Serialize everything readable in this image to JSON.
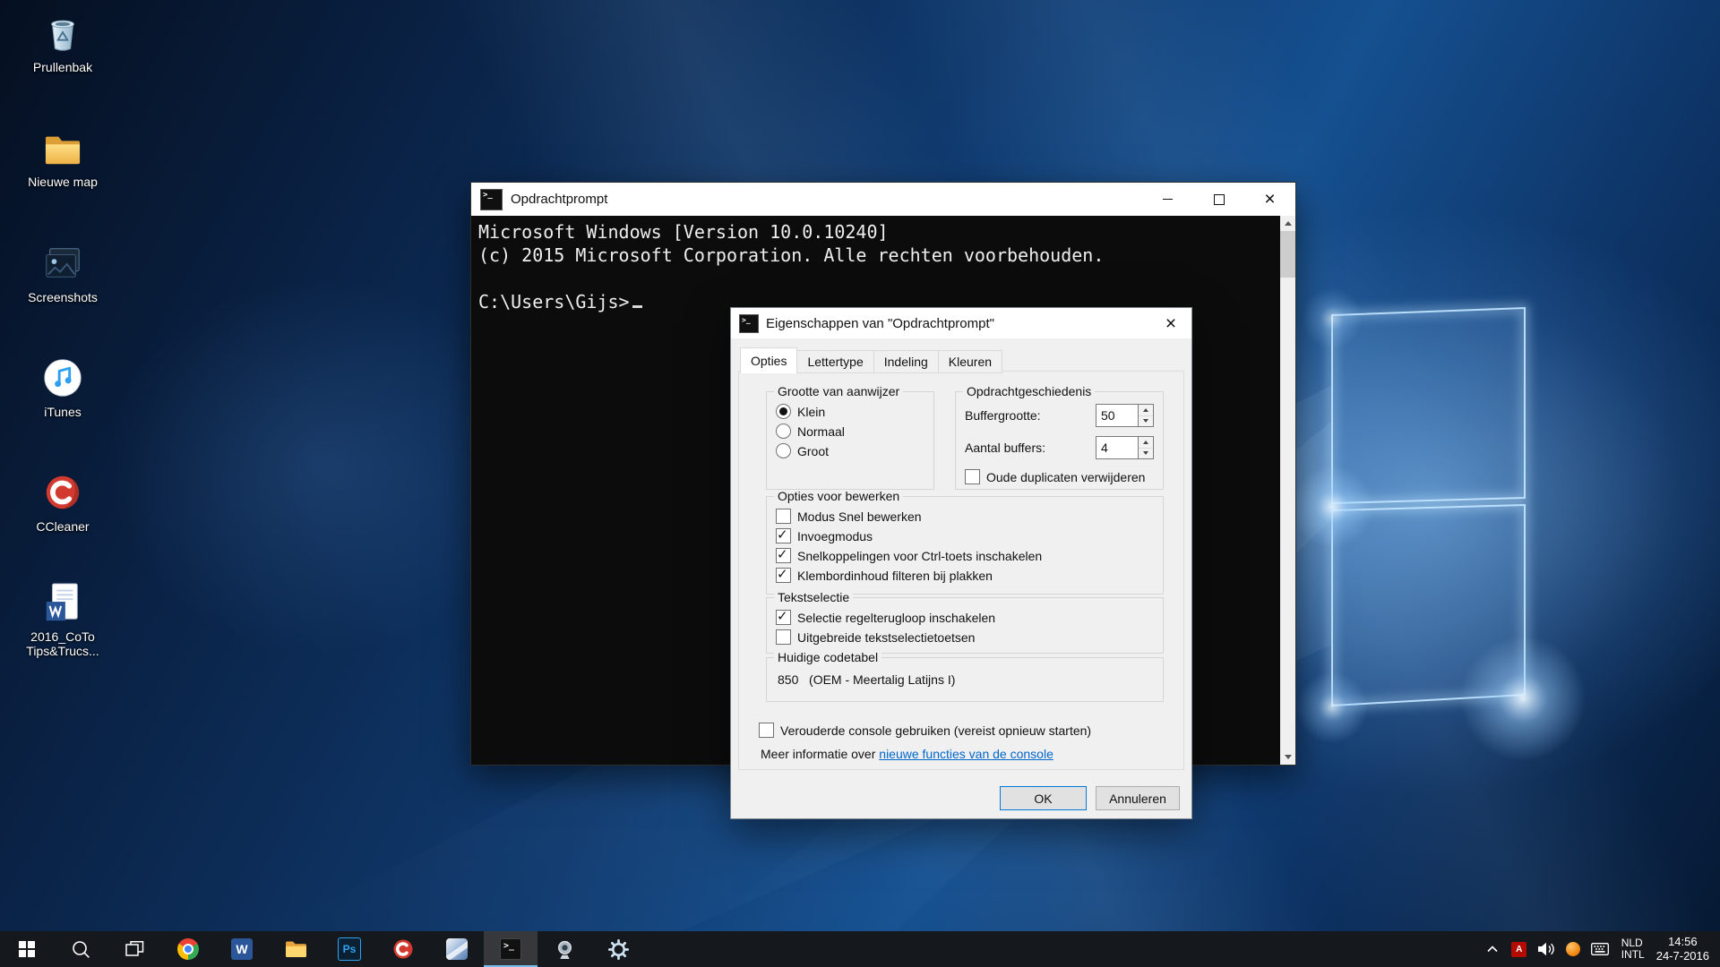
{
  "glyphs": {
    "cmd": ">_",
    "word": "W",
    "photoshop": "Ps",
    "adobe": "A"
  },
  "desktop": {
    "icons": [
      {
        "name": "recycle-bin",
        "label": "Prullenbak"
      },
      {
        "name": "new-folder",
        "label": "Nieuwe map"
      },
      {
        "name": "screenshots-folder",
        "label": "Screenshots"
      },
      {
        "name": "itunes",
        "label": "iTunes"
      },
      {
        "name": "ccleaner",
        "label": "CCleaner"
      },
      {
        "name": "word-document",
        "label": "2016_CoTo Tips&Trucs...",
        "line1": "2016_CoTo",
        "line2": "Tips&Trucs..."
      }
    ]
  },
  "console": {
    "title": "Opdrachtprompt",
    "line1": "Microsoft Windows [Version 10.0.10240]",
    "line2": "(c) 2015 Microsoft Corporation. Alle rechten voorbehouden.",
    "prompt": "C:\\Users\\Gijs>"
  },
  "dialog": {
    "title": "Eigenschappen van \"Opdrachtprompt\"",
    "tabs": [
      {
        "label": "Opties",
        "active": true
      },
      {
        "label": "Lettertype",
        "active": false
      },
      {
        "label": "Indeling",
        "active": false
      },
      {
        "label": "Kleuren",
        "active": false
      }
    ],
    "cursor_group": {
      "title": "Grootte van aanwijzer",
      "options": [
        {
          "label": "Klein",
          "selected": true
        },
        {
          "label": "Normaal",
          "selected": false
        },
        {
          "label": "Groot",
          "selected": false
        }
      ]
    },
    "history_group": {
      "title": "Opdrachtgeschiedenis",
      "buffer_label": "Buffergrootte:",
      "buffer_value": "50",
      "count_label": "Aantal buffers:",
      "count_value": "4",
      "dup_checkbox": {
        "label": "Oude duplicaten verwijderen",
        "checked": false
      }
    },
    "edit_group": {
      "title": "Opties voor bewerken",
      "items": [
        {
          "label": "Modus Snel bewerken",
          "checked": false
        },
        {
          "label": "Invoegmodus",
          "checked": true
        },
        {
          "label": "Snelkoppelingen voor Ctrl-toets inschakelen",
          "checked": true
        },
        {
          "label": "Klembordinhoud filteren bij plakken",
          "checked": true
        }
      ]
    },
    "selection_group": {
      "title": "Tekstselectie",
      "items": [
        {
          "label": "Selectie regelterugloop inschakelen",
          "checked": true
        },
        {
          "label": "Uitgebreide tekstselectietoetsen",
          "checked": false
        }
      ]
    },
    "codepage_group": {
      "title": "Huidige codetabel",
      "value": "850   (OEM - Meertalig Latijns I)"
    },
    "legacy_checkbox": {
      "label": "Verouderde console gebruiken (vereist opnieuw starten)",
      "checked": false
    },
    "info_prefix": "Meer informatie over ",
    "info_link": "nieuwe functies van de console",
    "ok_label": "OK",
    "cancel_label": "Annuleren"
  },
  "taskbar": {
    "apps": [
      "start",
      "search",
      "task-view",
      "chrome",
      "word",
      "file-explorer",
      "photoshop",
      "ccleaner",
      "blue-app",
      "command-prompt",
      "camera-app",
      "settings"
    ],
    "active_app": "command-prompt",
    "tray": {
      "lang1": "NLD",
      "lang2": "INTL",
      "time": "14:56",
      "date": "24-7-2016"
    }
  },
  "colors": {
    "accent": "#0078d7",
    "taskbar": "#15181d",
    "console_bg": "#0c0c0c",
    "dialog_bg": "#f0f0f0",
    "link": "#0066cc"
  }
}
